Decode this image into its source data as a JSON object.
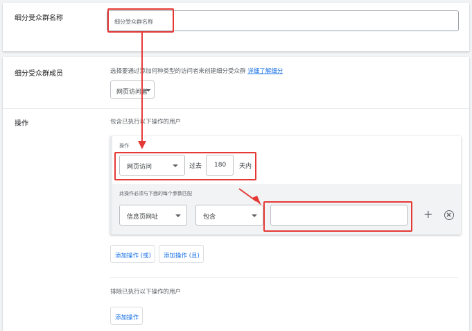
{
  "segment_name": {
    "label": "细分受众群名称",
    "value": "细分受众群名称"
  },
  "members": {
    "label": "细分受众群成员",
    "description": "选择要通过添加何种类型的访问者来创建细分受众群",
    "learn_more": "详细了解细分",
    "visitor_type": "网页访问者"
  },
  "actions": {
    "label": "操作",
    "include_header": "包含已执行以下操作的用户",
    "action_label": "操作",
    "action_type": "网页访问",
    "past_label": "过去",
    "days_value": "180",
    "days_unit": "天内",
    "params_label": "此操作必须与下面的每个参数匹配",
    "param_field": "信息页网址",
    "param_operator": "包含",
    "param_value": "",
    "add_or": "添加操作 (或)",
    "add_and": "添加操作 (且)",
    "exclude_header": "排除已执行以下操作的用户",
    "add_action": "添加操作"
  },
  "annotation_color": "#e53935",
  "accent_color": "#1a73e8"
}
